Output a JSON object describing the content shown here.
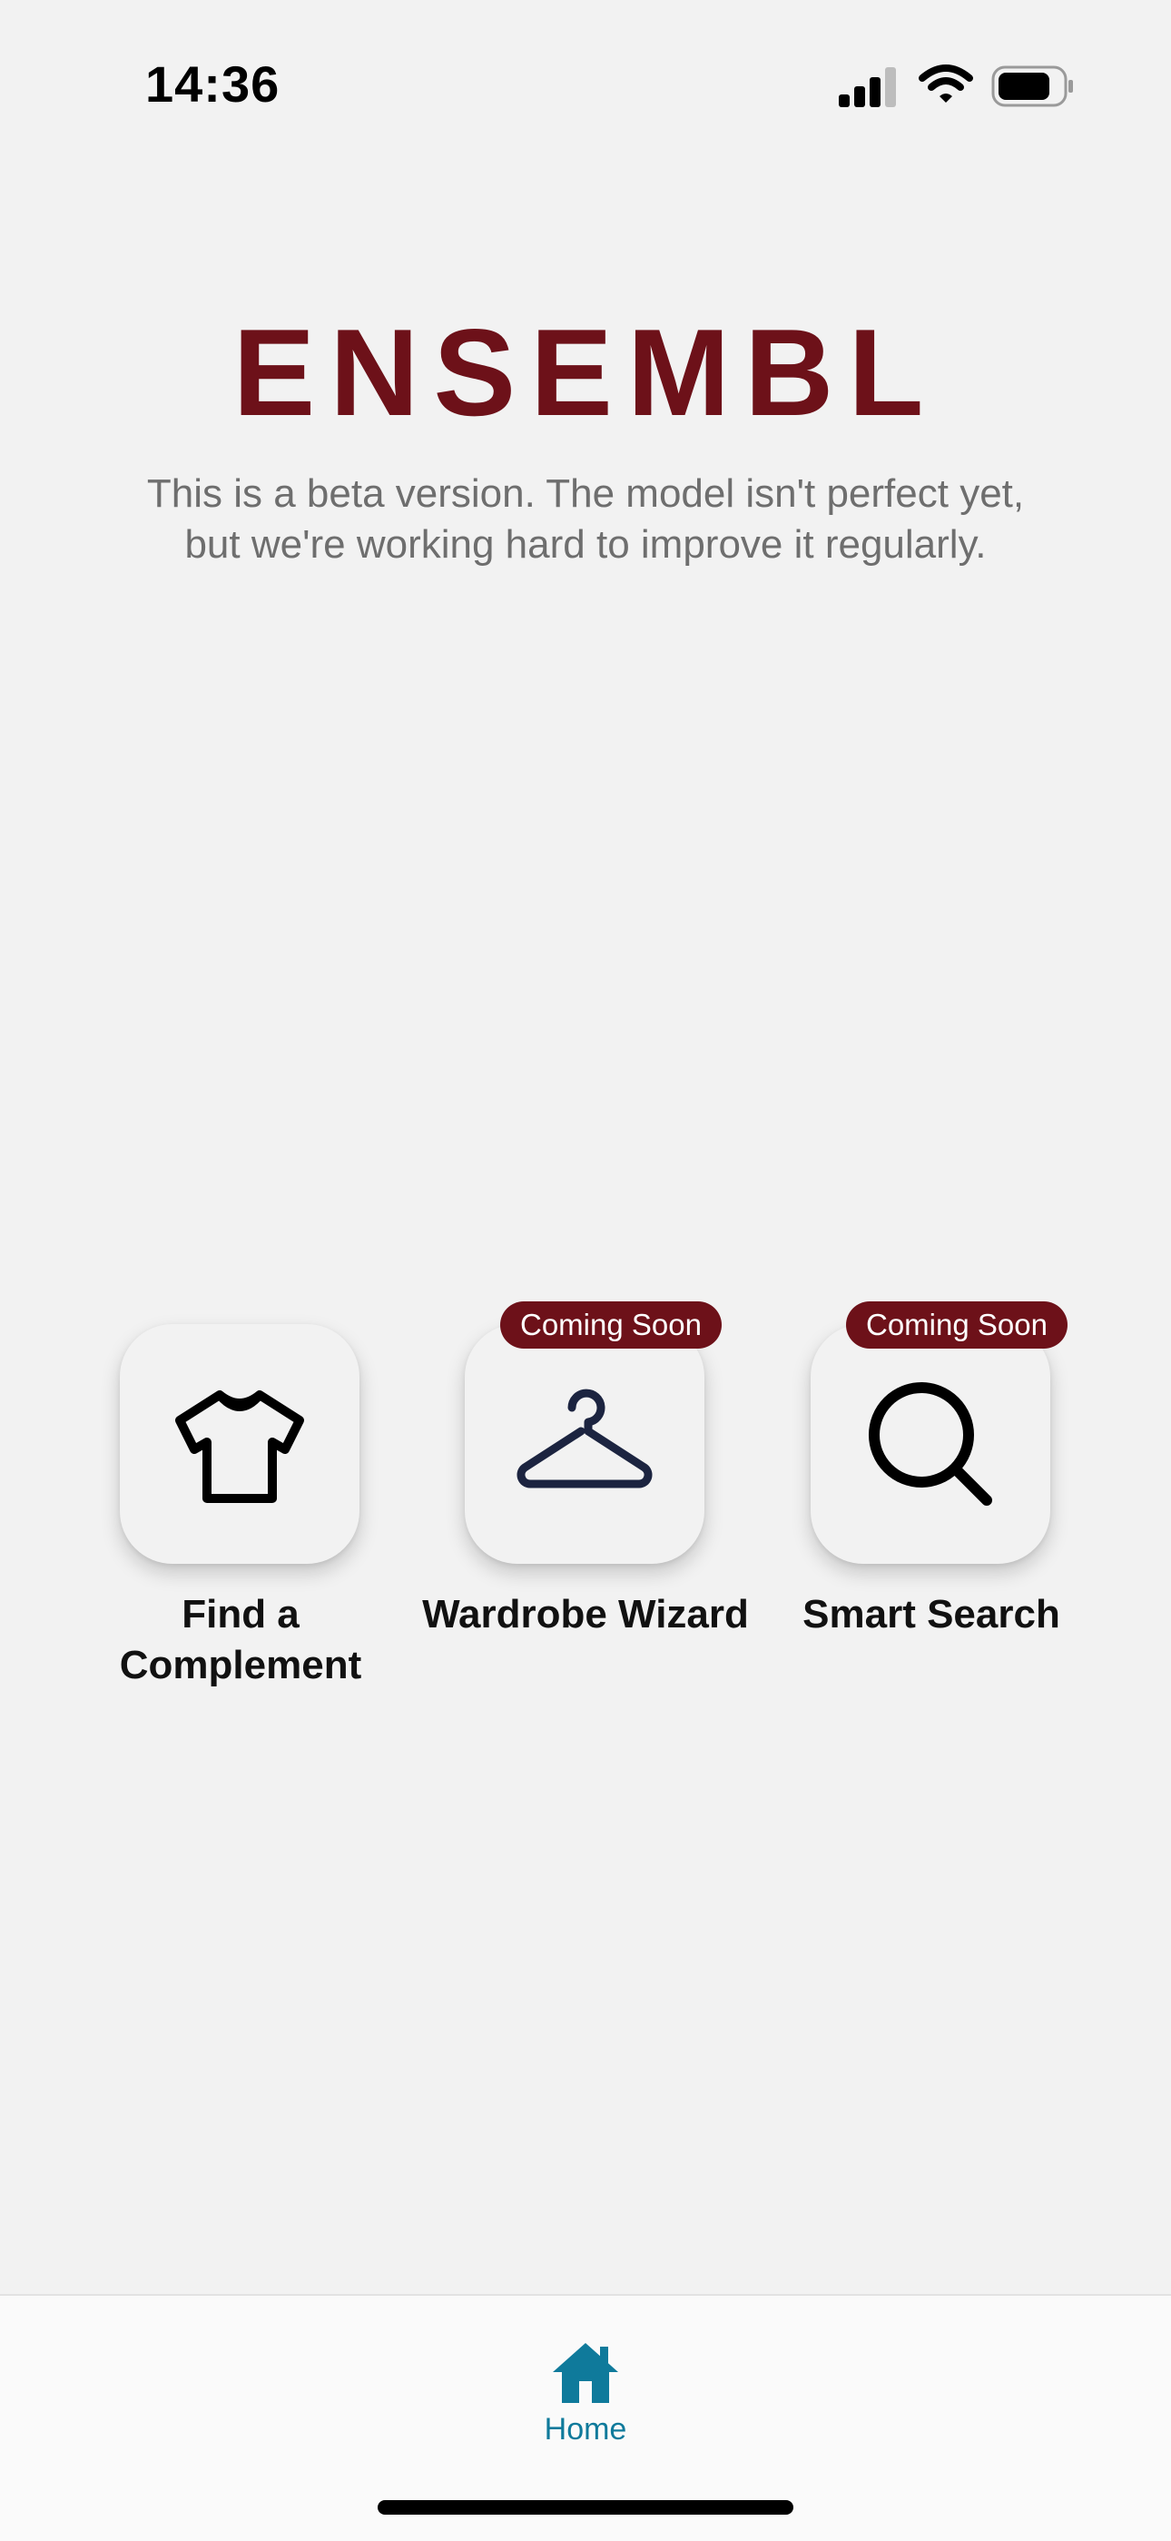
{
  "status_bar": {
    "time": "14:36"
  },
  "brand": {
    "title": "ENSEMBL",
    "beta_notice": "This is a beta version. The model isn't perfect yet, but we're working hard to improve it regularly.",
    "color": "#6d1119"
  },
  "features": [
    {
      "label": "Find a Complement",
      "icon": "t-shirt-icon",
      "badge": ""
    },
    {
      "label": "Wardrobe Wizard",
      "icon": "hanger-icon",
      "badge": "Coming Soon"
    },
    {
      "label": "Smart Search",
      "icon": "search-icon",
      "badge": "Coming Soon"
    }
  ],
  "tab_bar": {
    "tabs": [
      {
        "label": "Home",
        "icon": "home-icon",
        "active": true,
        "color": "#0f7a9b"
      }
    ]
  }
}
